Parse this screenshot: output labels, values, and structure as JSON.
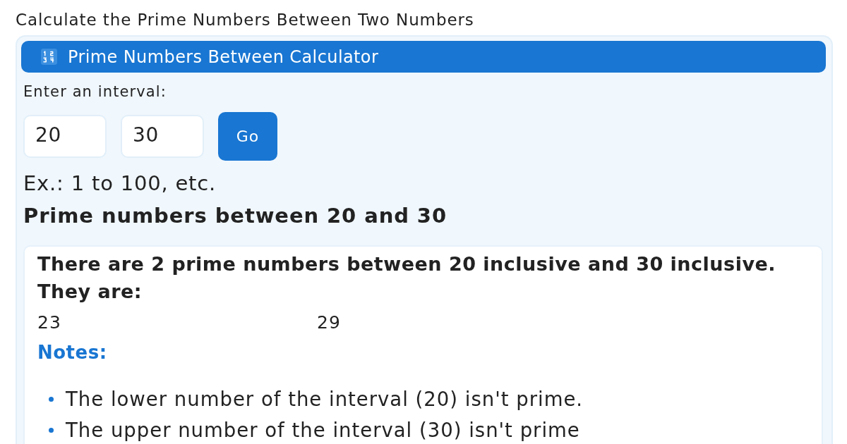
{
  "page_title": "Calculate the Prime Numbers Between Two Numbers",
  "calculator": {
    "title": "Prime Numbers Between Calculator",
    "prompt": "Enter an interval:",
    "inputs": [
      {
        "value": "20"
      },
      {
        "value": "30"
      }
    ],
    "button": "Go",
    "example": "Ex.: 1 to 100, etc."
  },
  "result": {
    "heading": "Prime numbers between 20 and 30",
    "summary": "There are 2 prime numbers between 20 inclusive and 30 inclusive.",
    "list_label": "They are:",
    "primes": [
      "23",
      "29"
    ],
    "notes_title": "Notes:",
    "notes": [
      "The lower number of the interval (20) isn't prime.",
      "The upper number of the interval (30) isn't prime"
    ]
  }
}
